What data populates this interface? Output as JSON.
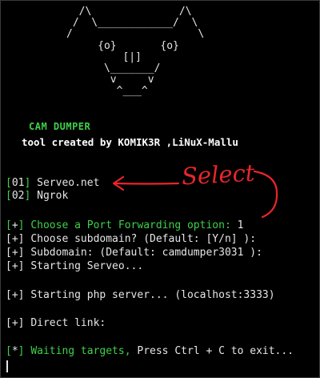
{
  "ascii_art": "  /\\              /\\\n /  \\____________/  \\\n/                    \\\n     {o}       {o}\n         [|]\n      \\_______/\n       v     v\n        ^___^",
  "header": {
    "title": "CAM DUMPER",
    "credit": "tool created by KOMIK3R ,LiNuX-Mallu"
  },
  "menu": [
    {
      "num": "01",
      "label": "Serveo.net"
    },
    {
      "num": "02",
      "label": "Ngrok"
    }
  ],
  "annotation": {
    "text": "Select",
    "color": "#e8262a"
  },
  "prompts": {
    "port_marker": "+",
    "port_question": "Choose a Port Forwarding option:",
    "port_answer": "1",
    "subdomain_question": "Choose subdomain? (Default: [Y/n] ):",
    "subdomain_value": "Subdomain: (Default: camdumper3031 ):",
    "starting_serveo": "Starting Serveo...",
    "starting_php": "Starting php server... (localhost:3333)",
    "direct_link": "Direct link:",
    "waiting_marker": "*",
    "waiting_green": "Waiting targets,",
    "waiting_white": "Press Ctrl + C to exit..."
  },
  "colors": {
    "green": "#3ed14a",
    "text": "#e6e6e6",
    "background": "#000000"
  }
}
